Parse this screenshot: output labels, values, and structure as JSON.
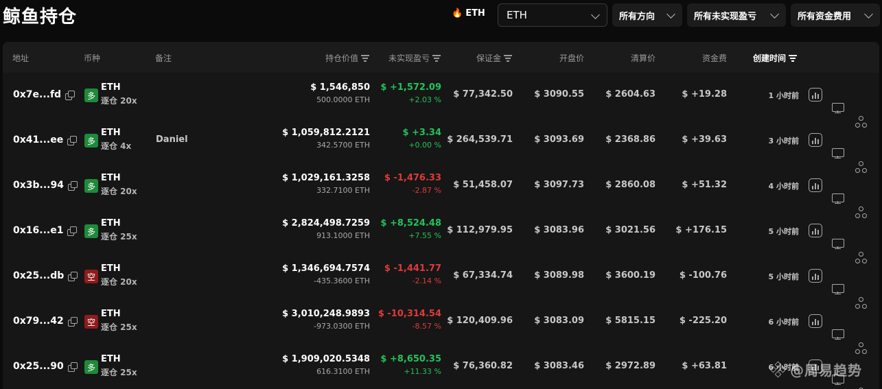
{
  "header": {
    "title": "鲸鱼持仓",
    "hot_asset_icon": "fire-icon",
    "hot_asset": "ETH",
    "asset_select_value": "ETH",
    "direction_filter": "所有方向",
    "pnl_filter": "所有未实现盈亏",
    "funding_filter": "所有资金费用"
  },
  "table": {
    "columns": {
      "address": "地址",
      "coin": "币种",
      "note": "备注",
      "position_value": "持仓价值",
      "unrealized_pnl": "未实现盈亏",
      "margin": "保证金",
      "open_price": "开盘价",
      "liq_price": "清算价",
      "funding_fee": "资金费",
      "created_time": "创建时间"
    },
    "rows": [
      {
        "address": "0x7e...fd",
        "side": "多",
        "side_type": "long",
        "coin": "ETH",
        "margin_mode": "逐仓 20x",
        "note": "",
        "position_value": "$ 1,546,850",
        "position_size": "500.0000 ETH",
        "pnl": "$ +1,572.09",
        "pnl_pct": "+2.03 %",
        "pnl_sign": "pos",
        "margin": "$ 77,342.50",
        "open_price": "$ 3090.55",
        "liq_price": "$ 2604.63",
        "funding": "$ +19.28",
        "funding_sign": "pos",
        "age": "1 小时前"
      },
      {
        "address": "0x41...ee",
        "side": "多",
        "side_type": "long",
        "coin": "ETH",
        "margin_mode": "逐仓 4x",
        "note": "Daniel",
        "position_value": "$ 1,059,812.2121",
        "position_size": "342.5700 ETH",
        "pnl": "$ +3.34",
        "pnl_pct": "+0.00 %",
        "pnl_sign": "pos",
        "margin": "$ 264,539.71",
        "open_price": "$ 3093.69",
        "liq_price": "$ 2368.86",
        "funding": "$ +39.63",
        "funding_sign": "pos",
        "age": "3 小时前"
      },
      {
        "address": "0x3b...94",
        "side": "多",
        "side_type": "long",
        "coin": "ETH",
        "margin_mode": "逐仓 20x",
        "note": "",
        "position_value": "$ 1,029,161.3258",
        "position_size": "332.7100 ETH",
        "pnl": "$ -1,476.33",
        "pnl_pct": "-2.87 %",
        "pnl_sign": "neg",
        "margin": "$ 51,458.07",
        "open_price": "$ 3097.73",
        "liq_price": "$ 2860.08",
        "funding": "$ +51.32",
        "funding_sign": "pos",
        "age": "4 小时前"
      },
      {
        "address": "0x16...e1",
        "side": "多",
        "side_type": "long",
        "coin": "ETH",
        "margin_mode": "逐仓 25x",
        "note": "",
        "position_value": "$ 2,824,498.7259",
        "position_size": "913.1000 ETH",
        "pnl": "$ +8,524.48",
        "pnl_pct": "+7.55 %",
        "pnl_sign": "pos",
        "margin": "$ 112,979.95",
        "open_price": "$ 3083.96",
        "liq_price": "$ 3021.56",
        "funding": "$ +176.15",
        "funding_sign": "pos",
        "age": "5 小时前"
      },
      {
        "address": "0x25...db",
        "side": "空",
        "side_type": "short",
        "coin": "ETH",
        "margin_mode": "逐仓 20x",
        "note": "",
        "position_value": "$ 1,346,694.7574",
        "position_size": "-435.3600 ETH",
        "pnl": "$ -1,441.77",
        "pnl_pct": "-2.14 %",
        "pnl_sign": "neg",
        "margin": "$ 67,334.74",
        "open_price": "$ 3089.98",
        "liq_price": "$ 3600.19",
        "funding": "$ -100.76",
        "funding_sign": "neg",
        "age": "5 小时前"
      },
      {
        "address": "0x79...42",
        "side": "空",
        "side_type": "short",
        "coin": "ETH",
        "margin_mode": "逐仓 25x",
        "note": "",
        "position_value": "$ 3,010,248.9893",
        "position_size": "-973.0300 ETH",
        "pnl": "$ -10,314.54",
        "pnl_pct": "-8.57 %",
        "pnl_sign": "neg",
        "margin": "$ 120,409.96",
        "open_price": "$ 3083.09",
        "liq_price": "$ 5815.15",
        "funding": "$ -225.20",
        "funding_sign": "neg",
        "age": "6 小时前"
      },
      {
        "address": "0x25...90",
        "side": "多",
        "side_type": "long",
        "coin": "ETH",
        "margin_mode": "逐仓 25x",
        "note": "",
        "position_value": "$ 1,909,020.5348",
        "position_size": "616.3100 ETH",
        "pnl": "$ +8,650.35",
        "pnl_pct": "+11.33 %",
        "pnl_sign": "pos",
        "margin": "$ 76,360.82",
        "open_price": "$ 3083.46",
        "liq_price": "$ 2972.89",
        "funding": "$ +63.81",
        "funding_sign": "pos",
        "age": "6 小时前"
      }
    ],
    "row_actions": [
      "chart-icon",
      "monitor-icon",
      "share-icon"
    ]
  },
  "watermark": {
    "text": "@周易趋势",
    "icon": "binance-square-logo"
  },
  "colors": {
    "background": "#0b0b0b",
    "panel": "#161616",
    "positive": "#23c25a",
    "negative": "#e03a3a",
    "long_badge": "#1e8a3a",
    "short_badge": "#8e1c1c"
  }
}
